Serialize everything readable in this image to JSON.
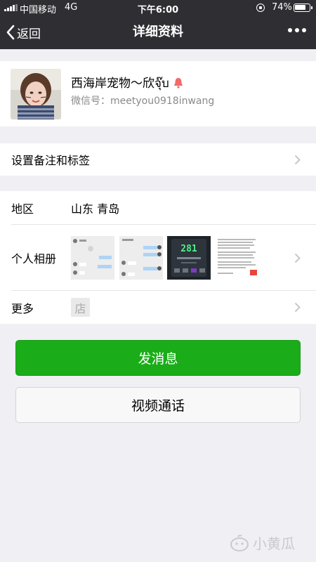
{
  "status_bar": {
    "carrier": "中国移动",
    "network": "4G",
    "time": "下午6:00",
    "battery_percent": "74%",
    "battery_level": 0.74
  },
  "nav": {
    "back_label": "返回",
    "title": "详细资料"
  },
  "profile": {
    "name": "西海岸宠物～欣จุ๊บ",
    "wechat_id": "微信号：meetyou0918inwang"
  },
  "remark_row": {
    "label": "设置备注和标签"
  },
  "region": {
    "label": "地区",
    "value": "山东 青岛"
  },
  "album": {
    "label": "个人相册",
    "thumb_text": "281"
  },
  "more": {
    "label": "更多",
    "store_glyph": "店"
  },
  "buttons": {
    "send_message": "发消息",
    "video_call": "视频通话"
  },
  "watermark": {
    "text": "小黄瓜"
  },
  "colors": {
    "nav_bg": "#2f2f33",
    "page_bg": "#efeff4",
    "primary_green": "#1aad19"
  }
}
